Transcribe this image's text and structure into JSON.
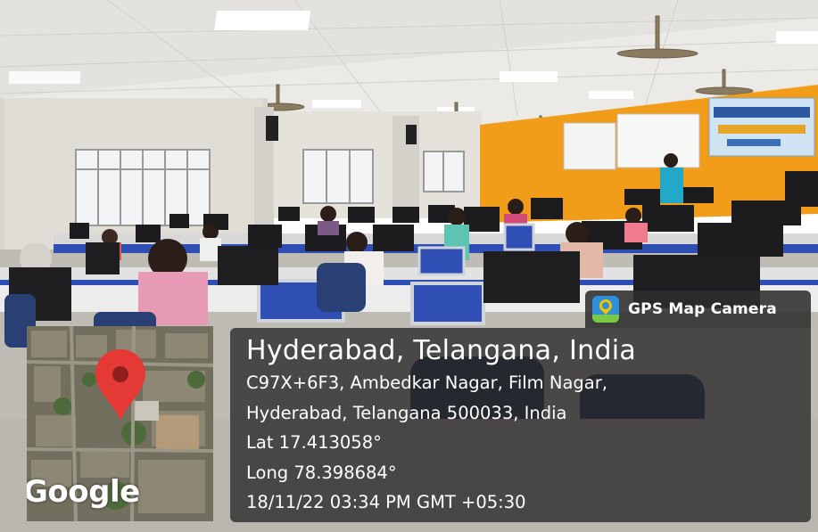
{
  "badge": {
    "icon": "gps-map-camera-icon",
    "label": "GPS Map Camera"
  },
  "location": {
    "title": "Hyderabad, Telangana, India",
    "address_line1": "C97X+6F3, Ambedkar Nagar, Film Nagar,",
    "address_line2": "Hyderabad, Telangana 500033, India",
    "latitude": "Lat 17.413058°",
    "longitude": "Long 78.398684°",
    "timestamp": "18/11/22 03:34 PM GMT +05:30"
  },
  "map_thumbnail": {
    "provider_label": "Google",
    "marker_icon": "map-pin-icon",
    "marker_color": "#e53935"
  },
  "colors": {
    "orange_wall": "#f29d1a",
    "partition_blue": "#2f4fb5",
    "overlay_dark": "#2a2a2a"
  }
}
